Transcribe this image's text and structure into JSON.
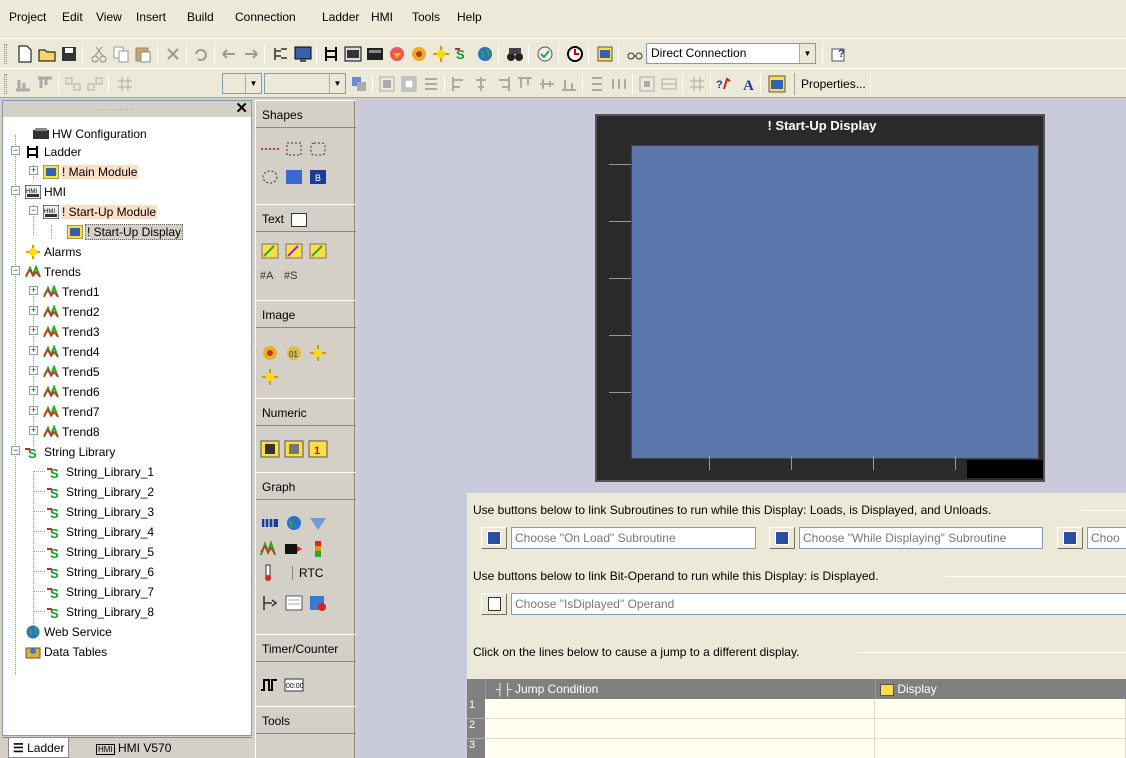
{
  "menu": [
    "Project",
    "Edit",
    "View",
    "Insert",
    "Build",
    "Connection",
    "Ladder",
    "HMI",
    "Tools",
    "Help"
  ],
  "toolbar": {
    "connection_value": "Direct Connection",
    "properties_label": "Properties..."
  },
  "tree": {
    "hw_config": "HW Configuration",
    "ladder": "Ladder",
    "main_module": "! Main Module",
    "hmi": "HMI",
    "startup_module": "! Start-Up Module",
    "startup_display": "! Start-Up Display",
    "alarms": "Alarms",
    "trends": "Trends",
    "trend_items": [
      "Trend1",
      "Trend2",
      "Trend3",
      "Trend4",
      "Trend5",
      "Trend6",
      "Trend7",
      "Trend8"
    ],
    "string_library": "String Library",
    "string_items": [
      "String_Library_1",
      "String_Library_2",
      "String_Library_3",
      "String_Library_4",
      "String_Library_5",
      "String_Library_6",
      "String_Library_7",
      "String_Library_8"
    ],
    "web_service": "Web Service",
    "data_tables": "Data Tables"
  },
  "bottom_tabs": [
    "Ladder",
    "HMI V570"
  ],
  "toolbox": {
    "shapes": "Shapes",
    "text": "Text",
    "image": "Image",
    "numeric": "Numeric",
    "graph": "Graph",
    "rtc": "RTC",
    "timer_counter": "Timer/Counter",
    "tools": "Tools"
  },
  "display": {
    "title": "! Start-Up Display"
  },
  "properties": {
    "subroutines_group": "Use buttons below to link Subroutines to run while this Display:  Loads, is Displayed, and Unloads.",
    "on_load_placeholder": "Choose \"On Load\" Subroutine",
    "while_displaying_placeholder": "Choose \"While Displaying\" Subroutine",
    "third_placeholder": "Choo",
    "bit_operand_group": "Use buttons below to link Bit-Operand to run while this Display: is Displayed.",
    "isdisplayed_placeholder": "Choose \"IsDiplayed\" Operand",
    "jump_group": "Click on the lines below to cause a jump to a different display.",
    "col_jump_condition": "Jump Condition",
    "col_display": "Display",
    "rows": [
      "1",
      "2",
      "3"
    ]
  },
  "colors": {
    "accent": "#2a4ea8",
    "screen": "#5a76ab",
    "highlight": "#fbe0c8"
  }
}
